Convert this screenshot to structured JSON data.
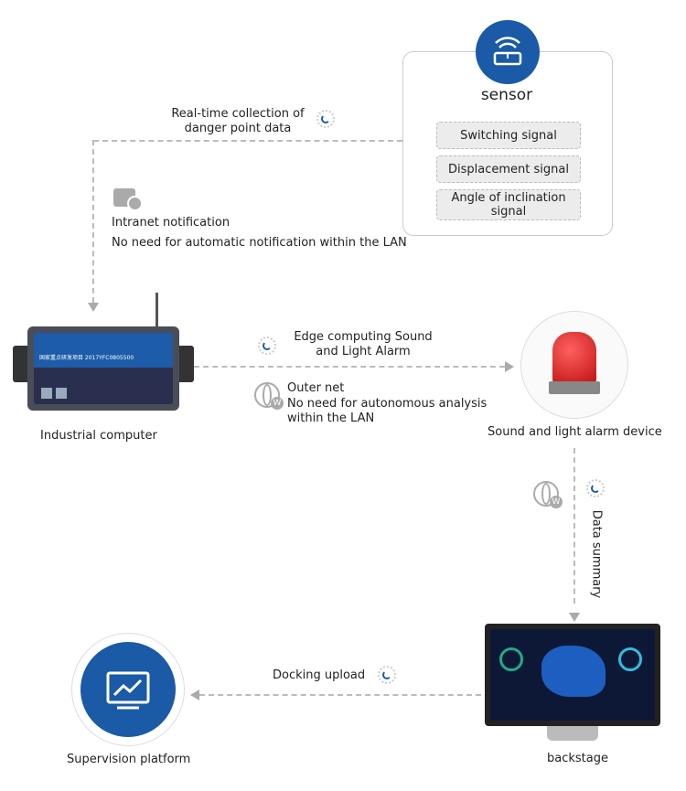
{
  "sensor": {
    "title": "sensor",
    "icon": "router-icon",
    "signals": [
      "Switching signal",
      "Displacement signal",
      "Angle of inclination signal"
    ]
  },
  "edges": {
    "collection": "Real-time collection of danger point data",
    "intranet_title": "Intranet notification",
    "intranet_desc": "No need for automatic notification within the LAN",
    "edge_alarm": "Edge computing Sound and Light Alarm",
    "outer_title": "Outer net",
    "outer_desc": "No need for autonomous analysis within the LAN",
    "data_summary": "Data summary",
    "docking": "Docking upload"
  },
  "nodes": {
    "industrial": "Industrial computer",
    "industrial_device_label": "国家重点研发项目  2017YFC0805500",
    "alarm": "Sound and light alarm device",
    "backstage": "backstage",
    "supervision": "Supervision platform"
  },
  "colors": {
    "accent": "#1a5aa6",
    "dash": "#bbbbbb",
    "alarm_red": "#d42020",
    "device_dark": "#2a2f4f"
  }
}
